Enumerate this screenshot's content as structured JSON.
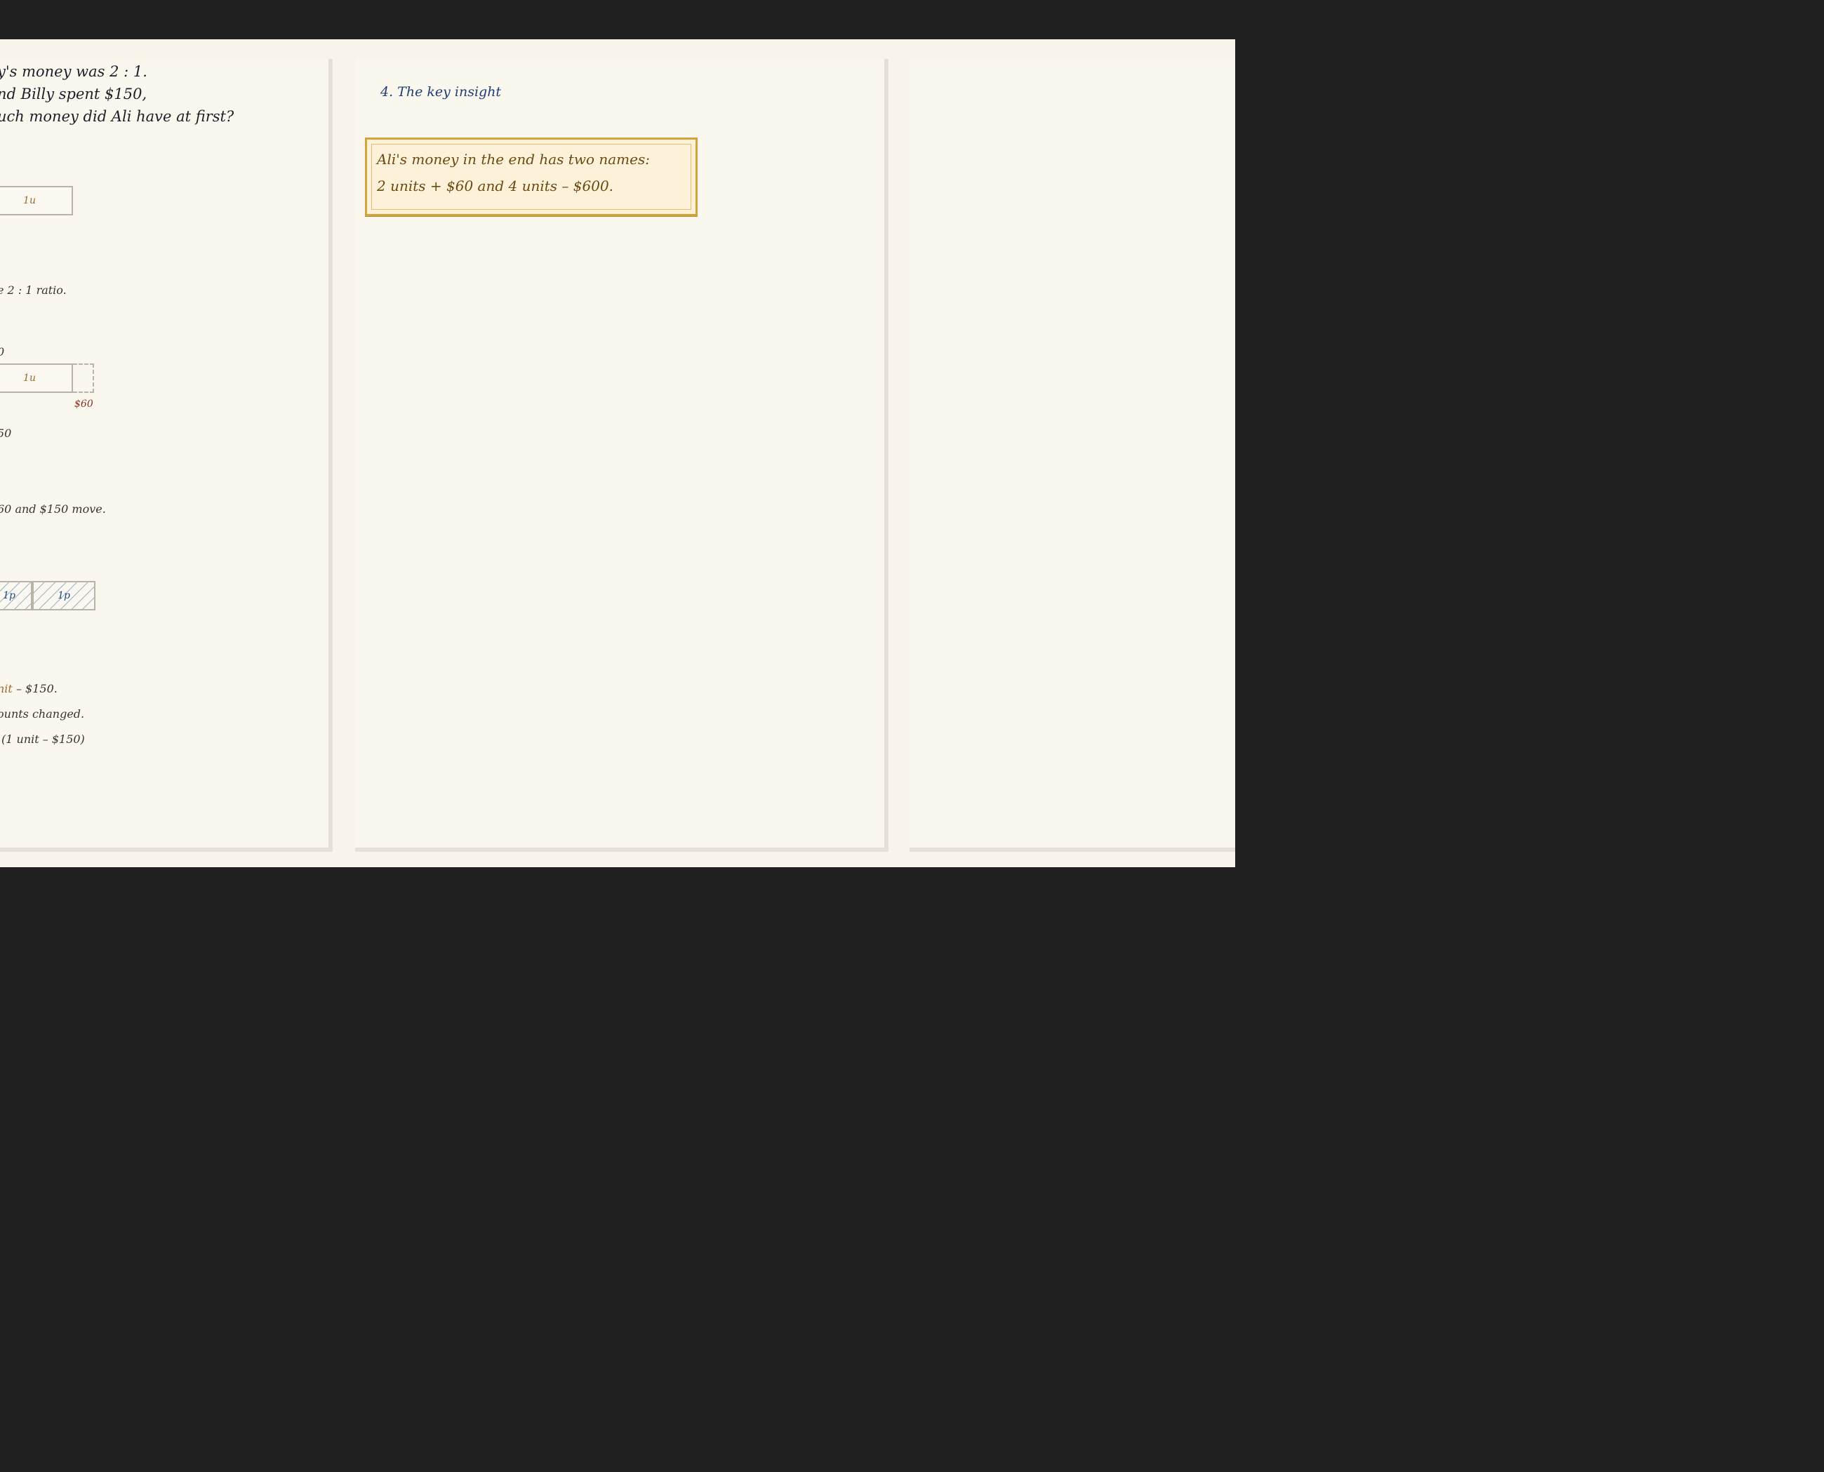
{
  "left_panel": {
    "problem_lines": [
      "y's money was 2 : 1.",
      "nd Billy spent $150,",
      "uch money did Ali have at first?"
    ],
    "unit_label_1": "1u",
    "ratio_note": "e 2 : 1 ratio.",
    "partial_0": "0",
    "unit_label_2": "1u",
    "amount_60": "$60",
    "partial_50": "50",
    "move_note": "60 and $150 move.",
    "part_label_a": "1p",
    "part_label_b": "1p",
    "unit_line_prefix": "nit",
    "unit_line_suffix": " – $150.",
    "changed_line": "ounts changed.",
    "formula_line": "(1 unit – $150)"
  },
  "middle_panel": {
    "section_title": "4. The key insight",
    "insight_lines": [
      "Ali's money in the end has two names:",
      "2 units + $60 and 4 units – $600."
    ]
  },
  "colors": {
    "background": "#202020",
    "paper": "#faf7ef",
    "insight_fill": "#fdf2d9",
    "insight_border": "#d3a43a",
    "title_blue": "#1d3f73"
  }
}
